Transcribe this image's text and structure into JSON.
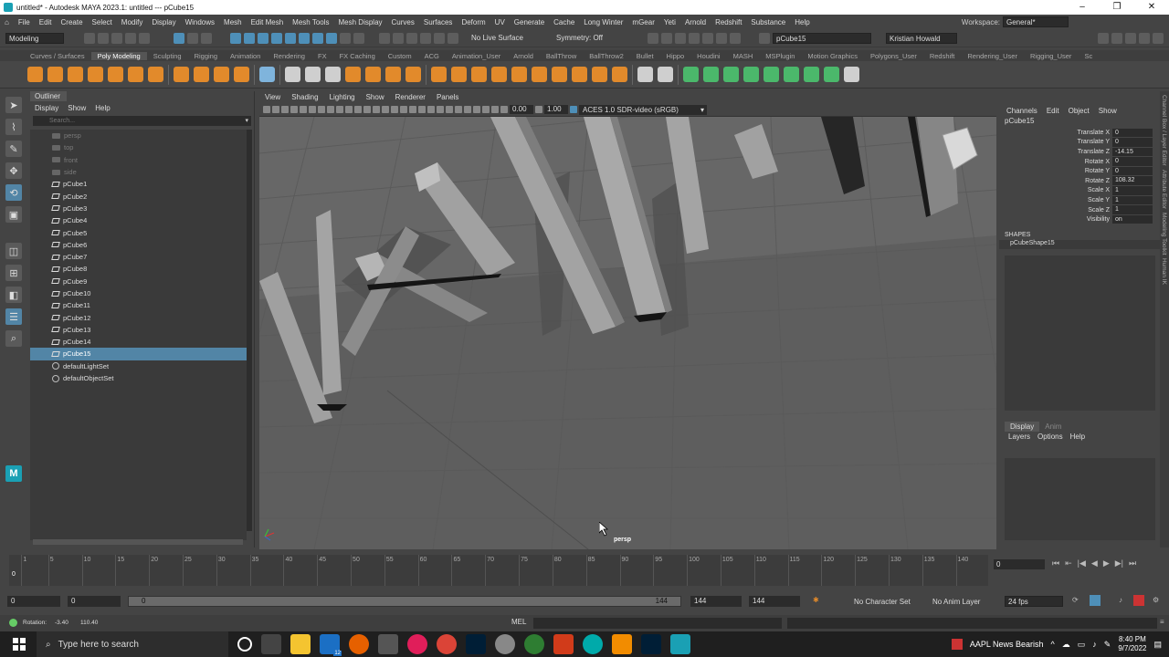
{
  "window": {
    "title": "untitled* - Autodesk MAYA 2023.1: untitled   ---   pCube15",
    "controls": [
      "–",
      "❐",
      "✕"
    ]
  },
  "menu": [
    "File",
    "Edit",
    "Create",
    "Select",
    "Modify",
    "Display",
    "Windows",
    "Mesh",
    "Edit Mesh",
    "Mesh Tools",
    "Mesh Display",
    "Curves",
    "Surfaces",
    "Deform",
    "UV",
    "Generate",
    "Cache",
    "Long Winter",
    "mGear",
    "Yeti",
    "Arnold",
    "Redshift",
    "Substance",
    "Help"
  ],
  "workspace": {
    "label": "Workspace:",
    "value": "General*"
  },
  "status": {
    "mode": "Modeling",
    "live_surface": "No Live Surface",
    "symmetry": "Symmetry: Off",
    "name_field": "pCube15",
    "user": "Kristian Howald"
  },
  "shelf_tabs": [
    "Curves / Surfaces",
    "Poly Modeling",
    "Sculpting",
    "Rigging",
    "Animation",
    "Rendering",
    "FX",
    "FX Caching",
    "Custom",
    "ACG",
    "Animation_User",
    "Arnold",
    "BallThrow",
    "BallThrow2",
    "Bullet",
    "Hippo",
    "Houdini",
    "MASH",
    "MSPlugin",
    "Motion Graphics",
    "Polygons_User",
    "Redshift",
    "Rendering_User",
    "Rigging_User",
    "Sc"
  ],
  "shelf_active": "Poly Modeling",
  "outliner": {
    "title": "Outliner",
    "menu": [
      "Display",
      "Show",
      "Help"
    ],
    "search_placeholder": "Search...",
    "items": [
      {
        "label": "persp",
        "kind": "camera",
        "dim": true
      },
      {
        "label": "top",
        "kind": "camera",
        "dim": true
      },
      {
        "label": "front",
        "kind": "camera",
        "dim": true
      },
      {
        "label": "side",
        "kind": "camera",
        "dim": true
      },
      {
        "label": "pCube1",
        "kind": "mesh"
      },
      {
        "label": "pCube2",
        "kind": "mesh"
      },
      {
        "label": "pCube3",
        "kind": "mesh"
      },
      {
        "label": "pCube4",
        "kind": "mesh"
      },
      {
        "label": "pCube5",
        "kind": "mesh"
      },
      {
        "label": "pCube6",
        "kind": "mesh"
      },
      {
        "label": "pCube7",
        "kind": "mesh"
      },
      {
        "label": "pCube8",
        "kind": "mesh"
      },
      {
        "label": "pCube9",
        "kind": "mesh"
      },
      {
        "label": "pCube10",
        "kind": "mesh"
      },
      {
        "label": "pCube11",
        "kind": "mesh"
      },
      {
        "label": "pCube12",
        "kind": "mesh"
      },
      {
        "label": "pCube13",
        "kind": "mesh"
      },
      {
        "label": "pCube14",
        "kind": "mesh"
      },
      {
        "label": "pCube15",
        "kind": "mesh",
        "selected": true
      },
      {
        "label": "defaultLightSet",
        "kind": "set"
      },
      {
        "label": "defaultObjectSet",
        "kind": "set"
      }
    ]
  },
  "viewport": {
    "menu": [
      "View",
      "Shading",
      "Lighting",
      "Show",
      "Renderer",
      "Panels"
    ],
    "exposure": "0.00",
    "gamma": "1.00",
    "color_space": "ACES 1.0 SDR-video (sRGB)",
    "camera_label": "persp"
  },
  "channel_box": {
    "menu": [
      "Channels",
      "Edit",
      "Object",
      "Show"
    ],
    "object": "pCube15",
    "attributes": [
      {
        "name": "Translate X",
        "value": "0"
      },
      {
        "name": "Translate Y",
        "value": "0"
      },
      {
        "name": "Translate Z",
        "value": "-14.15"
      },
      {
        "name": "Rotate X",
        "value": "0"
      },
      {
        "name": "Rotate Y",
        "value": "0"
      },
      {
        "name": "Rotate Z",
        "value": "108.32"
      },
      {
        "name": "Scale X",
        "value": "1"
      },
      {
        "name": "Scale Y",
        "value": "1"
      },
      {
        "name": "Scale Z",
        "value": "1"
      },
      {
        "name": "Visibility",
        "value": "on"
      }
    ],
    "shapes_header": "SHAPES",
    "shape": "pCubeShape15"
  },
  "layer_editor": {
    "tabs": [
      "Display",
      "Anim"
    ],
    "menu": [
      "Layers",
      "Options",
      "Help"
    ]
  },
  "side_tabs": [
    "Channel Box / Layer Editor",
    "Attribute Editor",
    "Modeling Toolkit",
    "Human IK"
  ],
  "timeline": {
    "ticks": [
      "1",
      "5",
      "10",
      "15",
      "20",
      "25",
      "30",
      "35",
      "40",
      "45",
      "50",
      "55",
      "60",
      "65",
      "70",
      "75",
      "80",
      "85",
      "90",
      "95",
      "100",
      "105",
      "110",
      "115",
      "120",
      "125",
      "130",
      "135",
      "140"
    ],
    "current_frame": "0",
    "playhead": "0"
  },
  "range": {
    "start": "0",
    "anim_start": "0",
    "range_start_label": "0",
    "range_end_label": "144",
    "anim_end": "144",
    "end": "144",
    "character": "No Character Set",
    "anim_layer": "No Anim Layer",
    "fps": "24 fps"
  },
  "help_line": {
    "rotation_label": "Rotation:",
    "rot1": "-3.40",
    "rot2": "110.40",
    "mel": "MEL"
  },
  "taskbar": {
    "search": "Type here to search",
    "stock": "AAPL  News Bearish",
    "time": "8:40 PM",
    "date": "9/7/2022",
    "badge": "12"
  }
}
